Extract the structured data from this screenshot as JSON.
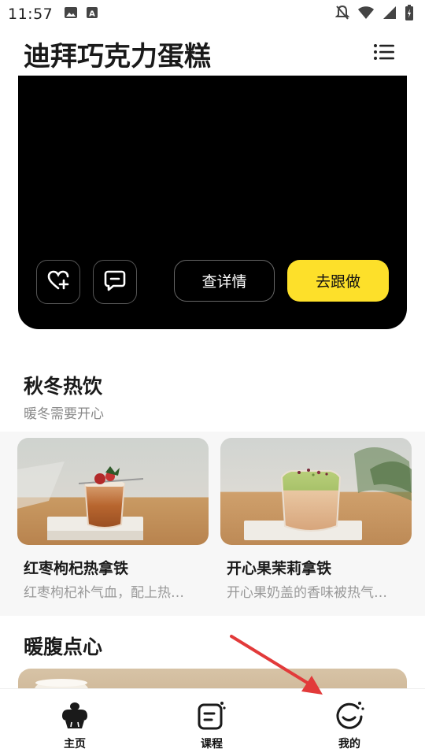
{
  "status_bar": {
    "time": "11:57",
    "icons": [
      "image-icon",
      "a-letter-icon",
      "notifications-off-icon",
      "wifi-icon",
      "signal-icon",
      "battery-charging-icon"
    ]
  },
  "header": {
    "title": "迪拜巧克力蛋糕",
    "menu_icon": "list-menu-icon"
  },
  "hero": {
    "favorite_icon": "heart-plus-icon",
    "comment_icon": "comment-icon",
    "detail_label": "查详情",
    "follow_label": "去跟做",
    "accent_color": "#fde02a"
  },
  "section_hot": {
    "title": "秋冬热饮",
    "subtitle": "暖冬需要开心",
    "cards": [
      {
        "title": "红枣枸杞热拿铁",
        "desc": "红枣枸杞补气血，配上热…"
      },
      {
        "title": "开心果茉莉拿铁",
        "desc": "开心果奶盖的香味被热气…"
      }
    ]
  },
  "section_snack": {
    "title": "暖腹点心"
  },
  "bottom_nav": {
    "items": [
      {
        "label": "主页",
        "icon": "cake-home-icon"
      },
      {
        "label": "课程",
        "icon": "course-icon"
      },
      {
        "label": "我的",
        "icon": "profile-smile-icon"
      }
    ]
  },
  "annotation": {
    "color": "#e23a3a"
  }
}
